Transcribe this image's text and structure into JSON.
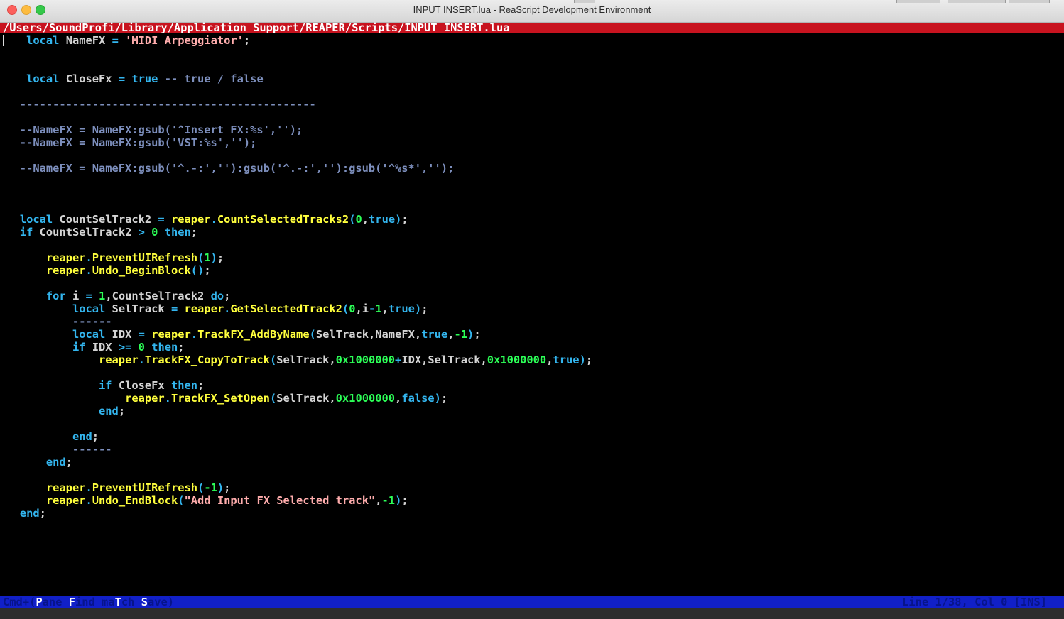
{
  "window": {
    "title": "INPUT INSERT.lua - ReaScript Development Environment"
  },
  "path_bar": {
    "path": "/Users/SoundProfi/Library/Application Support/REAPER/Scripts/INPUT INSERT.lua"
  },
  "code_lines": [
    {
      "n": 1,
      "tokens": [
        [
          "    ",
          "id"
        ],
        [
          "local",
          "kw"
        ],
        [
          " NameFX ",
          "id"
        ],
        [
          "=",
          "op"
        ],
        [
          " 'MIDI Arpeggiator'",
          "str"
        ],
        [
          ";",
          "pun"
        ]
      ]
    },
    {
      "n": 4,
      "tokens": [
        [
          "    ",
          "id"
        ],
        [
          "local",
          "kw"
        ],
        [
          " CloseFx ",
          "id"
        ],
        [
          "=",
          "op"
        ],
        [
          " true",
          "kw"
        ],
        [
          " -- true / false",
          "cm"
        ]
      ]
    },
    {
      "n": 6,
      "tokens": [
        [
          "   ---------------------------------------------",
          "cm"
        ]
      ]
    },
    {
      "n": 8,
      "tokens": [
        [
          "   --NameFX = NameFX:gsub('^Insert FX:%s','');",
          "cm"
        ]
      ]
    },
    {
      "n": 9,
      "tokens": [
        [
          "   --NameFX = NameFX:gsub('VST:%s','');",
          "cm"
        ]
      ]
    },
    {
      "n": 11,
      "tokens": [
        [
          "   --NameFX = NameFX:gsub('^.-:',''):gsub('^.-:',''):gsub('^%s*','');",
          "cm"
        ]
      ]
    },
    {
      "n": 15,
      "tokens": [
        [
          "   ",
          "id"
        ],
        [
          "local",
          "kw"
        ],
        [
          " CountSelTrack2 ",
          "id"
        ],
        [
          "=",
          "op"
        ],
        [
          " reaper",
          "fn"
        ],
        [
          ".",
          "op"
        ],
        [
          "CountSelectedTracks2",
          "fn"
        ],
        [
          "(",
          "op"
        ],
        [
          "0",
          "num"
        ],
        [
          ",",
          "pun"
        ],
        [
          "true",
          "kw"
        ],
        [
          ")",
          "op"
        ],
        [
          ";",
          "pun"
        ]
      ]
    },
    {
      "n": 16,
      "tokens": [
        [
          "   ",
          "id"
        ],
        [
          "if",
          "kw"
        ],
        [
          " CountSelTrack2 ",
          "id"
        ],
        [
          ">",
          "op"
        ],
        [
          " 0",
          "num"
        ],
        [
          " then",
          "kw"
        ],
        [
          ";",
          "pun"
        ]
      ]
    },
    {
      "n": 18,
      "tokens": [
        [
          "       ",
          "id"
        ],
        [
          "reaper",
          "fn"
        ],
        [
          ".",
          "op"
        ],
        [
          "PreventUIRefresh",
          "fn"
        ],
        [
          "(",
          "op"
        ],
        [
          "1",
          "num"
        ],
        [
          ")",
          "op"
        ],
        [
          ";",
          "pun"
        ]
      ]
    },
    {
      "n": 19,
      "tokens": [
        [
          "       ",
          "id"
        ],
        [
          "reaper",
          "fn"
        ],
        [
          ".",
          "op"
        ],
        [
          "Undo_BeginBlock",
          "fn"
        ],
        [
          "()",
          "op"
        ],
        [
          ";",
          "pun"
        ]
      ]
    },
    {
      "n": 21,
      "tokens": [
        [
          "       ",
          "id"
        ],
        [
          "for",
          "kw"
        ],
        [
          " i ",
          "id"
        ],
        [
          "=",
          "op"
        ],
        [
          " 1",
          "num"
        ],
        [
          ",CountSelTrack2 ",
          "id"
        ],
        [
          "do",
          "kw"
        ],
        [
          ";",
          "pun"
        ]
      ]
    },
    {
      "n": 22,
      "tokens": [
        [
          "           ",
          "id"
        ],
        [
          "local",
          "kw"
        ],
        [
          " SelTrack ",
          "id"
        ],
        [
          "=",
          "op"
        ],
        [
          " reaper",
          "fn"
        ],
        [
          ".",
          "op"
        ],
        [
          "GetSelectedTrack2",
          "fn"
        ],
        [
          "(",
          "op"
        ],
        [
          "0",
          "num"
        ],
        [
          ",i",
          "id"
        ],
        [
          "-",
          "op"
        ],
        [
          "1",
          "num"
        ],
        [
          ",",
          "pun"
        ],
        [
          "true",
          "kw"
        ],
        [
          ")",
          "op"
        ],
        [
          ";",
          "pun"
        ]
      ]
    },
    {
      "n": 23,
      "tokens": [
        [
          "           ------",
          "cm"
        ]
      ]
    },
    {
      "n": 24,
      "tokens": [
        [
          "           ",
          "id"
        ],
        [
          "local",
          "kw"
        ],
        [
          " IDX ",
          "id"
        ],
        [
          "=",
          "op"
        ],
        [
          " reaper",
          "fn"
        ],
        [
          ".",
          "op"
        ],
        [
          "TrackFX_AddByName",
          "fn"
        ],
        [
          "(",
          "op"
        ],
        [
          "SelTrack,NameFX,",
          "id"
        ],
        [
          "true",
          "kw"
        ],
        [
          ",",
          "pun"
        ],
        [
          "-1",
          "num"
        ],
        [
          ")",
          "op"
        ],
        [
          ";",
          "pun"
        ]
      ]
    },
    {
      "n": 25,
      "tokens": [
        [
          "           ",
          "id"
        ],
        [
          "if",
          "kw"
        ],
        [
          " IDX ",
          "id"
        ],
        [
          ">=",
          "op"
        ],
        [
          " 0",
          "num"
        ],
        [
          " then",
          "kw"
        ],
        [
          ";",
          "pun"
        ]
      ]
    },
    {
      "n": 26,
      "tokens": [
        [
          "               ",
          "id"
        ],
        [
          "reaper",
          "fn"
        ],
        [
          ".",
          "op"
        ],
        [
          "TrackFX_CopyToTrack",
          "fn"
        ],
        [
          "(",
          "op"
        ],
        [
          "SelTrack,",
          "id"
        ],
        [
          "0x1000000",
          "num"
        ],
        [
          "+",
          "op"
        ],
        [
          "IDX,SelTrack,",
          "id"
        ],
        [
          "0x1000000",
          "num"
        ],
        [
          ",",
          "pun"
        ],
        [
          "true",
          "kw"
        ],
        [
          ")",
          "op"
        ],
        [
          ";",
          "pun"
        ]
      ]
    },
    {
      "n": 28,
      "tokens": [
        [
          "               ",
          "id"
        ],
        [
          "if",
          "kw"
        ],
        [
          " CloseFx ",
          "id"
        ],
        [
          "then",
          "kw"
        ],
        [
          ";",
          "pun"
        ]
      ]
    },
    {
      "n": 29,
      "tokens": [
        [
          "                   ",
          "id"
        ],
        [
          "reaper",
          "fn"
        ],
        [
          ".",
          "op"
        ],
        [
          "TrackFX_SetOpen",
          "fn"
        ],
        [
          "(",
          "op"
        ],
        [
          "SelTrack,",
          "id"
        ],
        [
          "0x1000000",
          "num"
        ],
        [
          ",",
          "pun"
        ],
        [
          "false",
          "kw"
        ],
        [
          ")",
          "op"
        ],
        [
          ";",
          "pun"
        ]
      ]
    },
    {
      "n": 30,
      "tokens": [
        [
          "               ",
          "id"
        ],
        [
          "end",
          "kw"
        ],
        [
          ";",
          "pun"
        ]
      ]
    },
    {
      "n": 32,
      "tokens": [
        [
          "           ",
          "id"
        ],
        [
          "end",
          "kw"
        ],
        [
          ";",
          "pun"
        ]
      ]
    },
    {
      "n": 33,
      "tokens": [
        [
          "           ------",
          "cm"
        ]
      ]
    },
    {
      "n": 34,
      "tokens": [
        [
          "       ",
          "id"
        ],
        [
          "end",
          "kw"
        ],
        [
          ";",
          "pun"
        ]
      ]
    },
    {
      "n": 36,
      "tokens": [
        [
          "       ",
          "id"
        ],
        [
          "reaper",
          "fn"
        ],
        [
          ".",
          "op"
        ],
        [
          "PreventUIRefresh",
          "fn"
        ],
        [
          "(",
          "op"
        ],
        [
          "-1",
          "num"
        ],
        [
          ")",
          "op"
        ],
        [
          ";",
          "pun"
        ]
      ]
    },
    {
      "n": 37,
      "tokens": [
        [
          "       ",
          "id"
        ],
        [
          "reaper",
          "fn"
        ],
        [
          ".",
          "op"
        ],
        [
          "Undo_EndBlock",
          "fn"
        ],
        [
          "(",
          "op"
        ],
        [
          "\"Add Input FX Selected track\"",
          "str"
        ],
        [
          ",",
          "pun"
        ],
        [
          "-1",
          "num"
        ],
        [
          ")",
          "op"
        ],
        [
          ";",
          "pun"
        ]
      ]
    },
    {
      "n": 38,
      "tokens": [
        [
          "   ",
          "id"
        ],
        [
          "end",
          "kw"
        ],
        [
          ";",
          "pun"
        ]
      ]
    }
  ],
  "status_bar": {
    "left": [
      [
        "Cmd+(",
        0
      ],
      [
        "P",
        1
      ],
      [
        "ane ",
        0
      ],
      [
        "F",
        1
      ],
      [
        "ind ma",
        0
      ],
      [
        "T",
        1
      ],
      [
        "ch ",
        0
      ],
      [
        "S",
        1
      ],
      [
        "ave)",
        0
      ]
    ],
    "right": "Line 1/38, Col 0 [INS]"
  },
  "colors": {
    "path_bar": "#c8131f",
    "status_bar": "#1120c8",
    "keyword": "#33b5ee",
    "function": "#ffff3d",
    "number": "#2cff57",
    "string": "#ffadad",
    "comment": "#7d8fbd"
  }
}
